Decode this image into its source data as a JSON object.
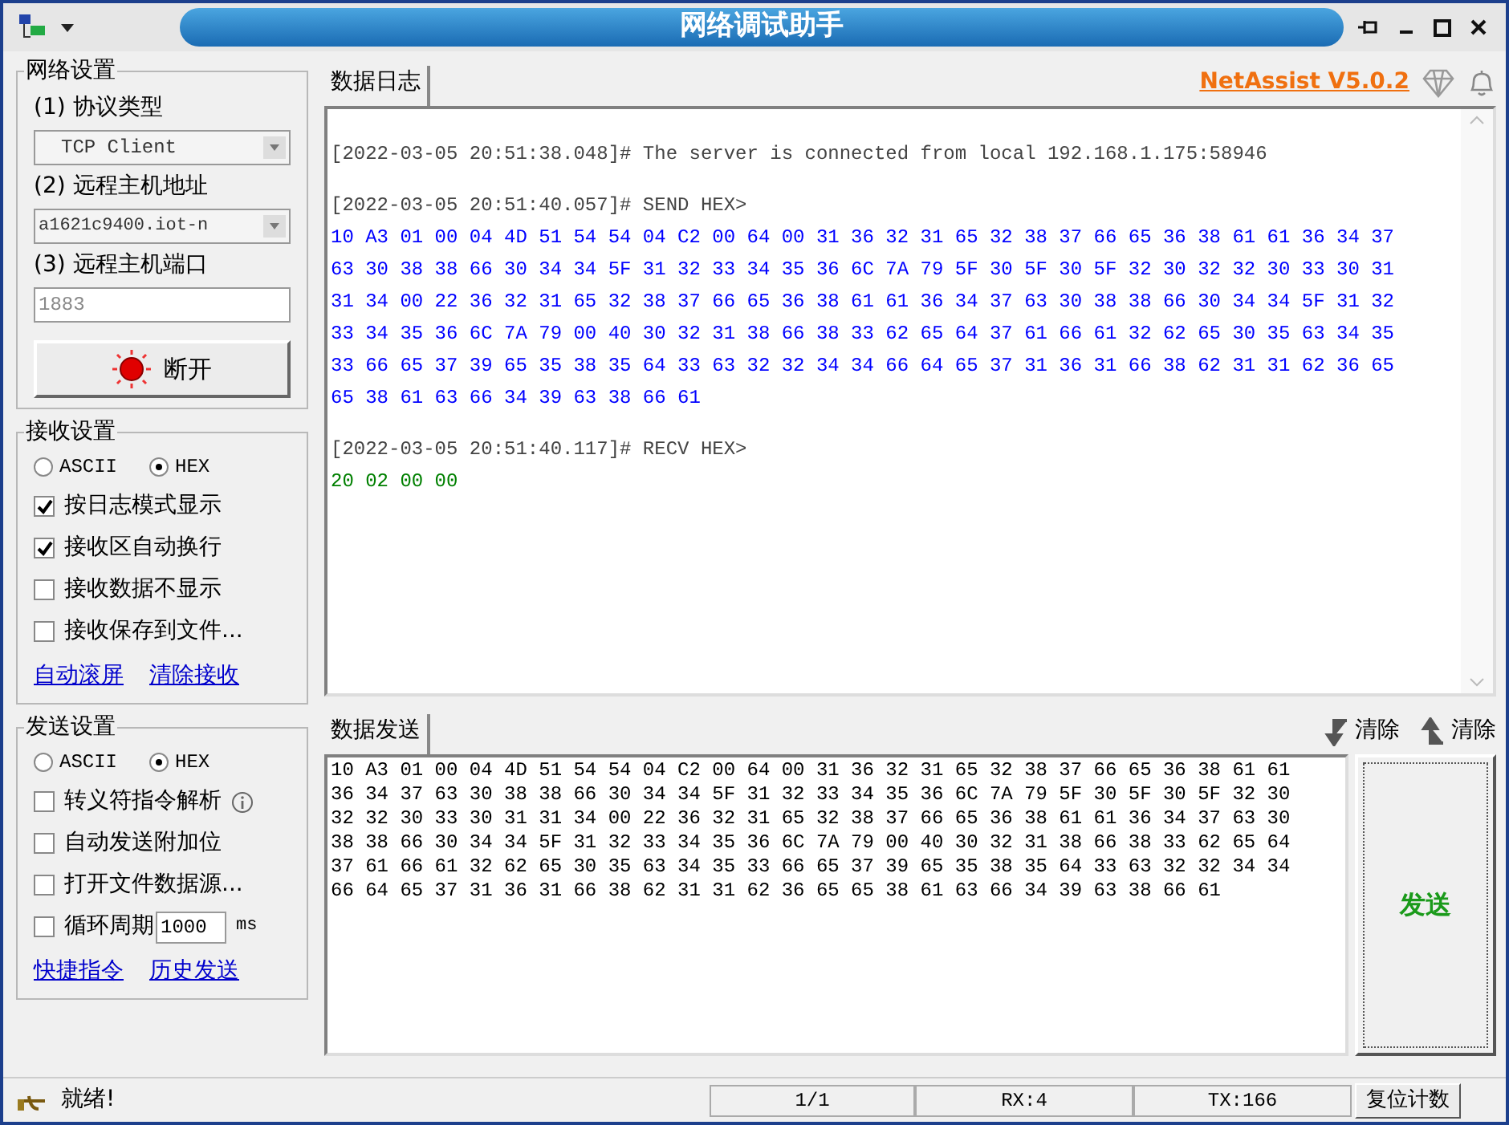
{
  "window": {
    "title": "网络调试助手"
  },
  "network_settings": {
    "title": "网络设置",
    "protocol": {
      "label": "(1) 协议类型",
      "value": "TCP Client"
    },
    "host": {
      "label": "(2) 远程主机地址",
      "value": "a1621c9400.iot-n"
    },
    "port": {
      "label": "(3) 远程主机端口",
      "value": "1883",
      "disabled": true
    },
    "connect_button": {
      "label": "断开"
    }
  },
  "receive_settings": {
    "title": "接收设置",
    "modes": [
      {
        "label": "ASCII",
        "selected": false
      },
      {
        "label": "HEX",
        "selected": true
      }
    ],
    "options": [
      {
        "label": "按日志模式显示",
        "checked": true
      },
      {
        "label": "接收区自动换行",
        "checked": true
      },
      {
        "label": "接收数据不显示",
        "checked": false
      },
      {
        "label": "接收保存到文件...",
        "checked": false
      }
    ],
    "links": [
      "自动滚屏",
      "清除接收"
    ]
  },
  "send_settings": {
    "title": "发送设置",
    "modes": [
      {
        "label": "ASCII",
        "selected": false
      },
      {
        "label": "HEX",
        "selected": true
      }
    ],
    "options": [
      {
        "kind": "info",
        "label": "转义符指令解析",
        "checked": false
      },
      {
        "kind": "plain",
        "label": "自动发送附加位",
        "checked": false
      },
      {
        "kind": "plain",
        "label": "打开文件数据源...",
        "checked": false
      },
      {
        "kind": "period",
        "label": "循环周期",
        "checked": false,
        "value": "1000",
        "unit": "ms"
      }
    ],
    "links": [
      "快捷指令",
      "历史发送"
    ]
  },
  "log": {
    "tab": "数据日志",
    "version": "NetAssist V5.0.2",
    "entries": [
      {
        "kind": "info",
        "header": "[2022-03-05 20:51:38.048]# The server is connected from local 192.168.1.175:58946"
      },
      {
        "kind": "send",
        "header": "[2022-03-05 20:51:40.057]# SEND HEX>",
        "lines": [
          "10 A3 01 00 04 4D 51 54 54 04 C2 00 64 00 31 36 32 31 65 32 38 37 66 65 36 38 61 61 36 34 37",
          "63 30 38 38 66 30 34 34 5F 31 32 33 34 35 36 6C 7A 79 5F 30 5F 30 5F 32 30 32 32 30 33 30 31",
          "31 34 00 22 36 32 31 65 32 38 37 66 65 36 38 61 61 36 34 37 63 30 38 38 66 30 34 34 5F 31 32",
          "33 34 35 36 6C 7A 79 00 40 30 32 31 38 66 38 33 62 65 64 37 61 66 61 32 62 65 30 35 63 34 35",
          "33 66 65 37 39 65 35 38 35 64 33 63 32 32 34 34 66 64 65 37 31 36 31 66 38 62 31 31 62 36 65",
          "65 38 61 63 66 34 39 63 38 66 61"
        ]
      },
      {
        "kind": "recv",
        "header": "[2022-03-05 20:51:40.117]# RECV HEX>",
        "lines": [
          "20 02 00 00"
        ]
      }
    ]
  },
  "send_panel": {
    "tab": "数据发送",
    "clear_receive": "清除",
    "clear_send": "清除",
    "lines": [
      "10 A3 01 00 04 4D 51 54 54 04 C2 00 64 00 31 36 32 31 65 32 38 37 66 65 36 38 61 61",
      "36 34 37 63 30 38 38 66 30 34 34 5F 31 32 33 34 35 36 6C 7A 79 5F 30 5F 30 5F 32 30",
      "32 32 30 33 30 31 31 34 00 22 36 32 31 65 32 38 37 66 65 36 38 61 61 36 34 37 63 30",
      "38 38 66 30 34 34 5F 31 32 33 34 35 36 6C 7A 79 00 40 30 32 31 38 66 38 33 62 65 64",
      "37 61 66 61 32 62 65 30 35 63 34 35 33 66 65 37 39 65 35 38 35 64 33 63 32 32 34 34",
      "66 64 65 37 31 36 31 66 38 62 31 31 62 36 65 65 38 61 63 66 34 39 63 38 66 61"
    ],
    "send_button": "发送"
  },
  "status_bar": {
    "message": "就绪!",
    "page": "1/1",
    "rx": "RX:4",
    "tx": "TX:166",
    "reset_button": "复位计数"
  }
}
